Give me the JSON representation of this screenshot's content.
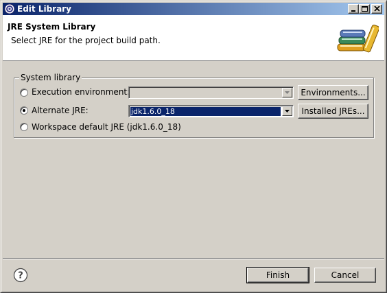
{
  "window": {
    "title": "Edit Library"
  },
  "header": {
    "title": "JRE System Library",
    "description": "Select JRE for the project build path."
  },
  "group": {
    "legend": "System library",
    "execution_env": {
      "label": "Execution environment:",
      "value": "",
      "button": "Environments..."
    },
    "alternate_jre": {
      "label": "Alternate JRE:",
      "value": "jdk1.6.0_18",
      "button": "Installed JREs..."
    },
    "workspace_default": {
      "label": "Workspace default JRE (jdk1.6.0_18)"
    },
    "selected": "alternate_jre"
  },
  "footer": {
    "finish": "Finish",
    "cancel": "Cancel"
  },
  "colors": {
    "titlebar_start": "#0a246a",
    "titlebar_end": "#a6caf0",
    "selection": "#0a246a",
    "face": "#d4d0c8"
  }
}
